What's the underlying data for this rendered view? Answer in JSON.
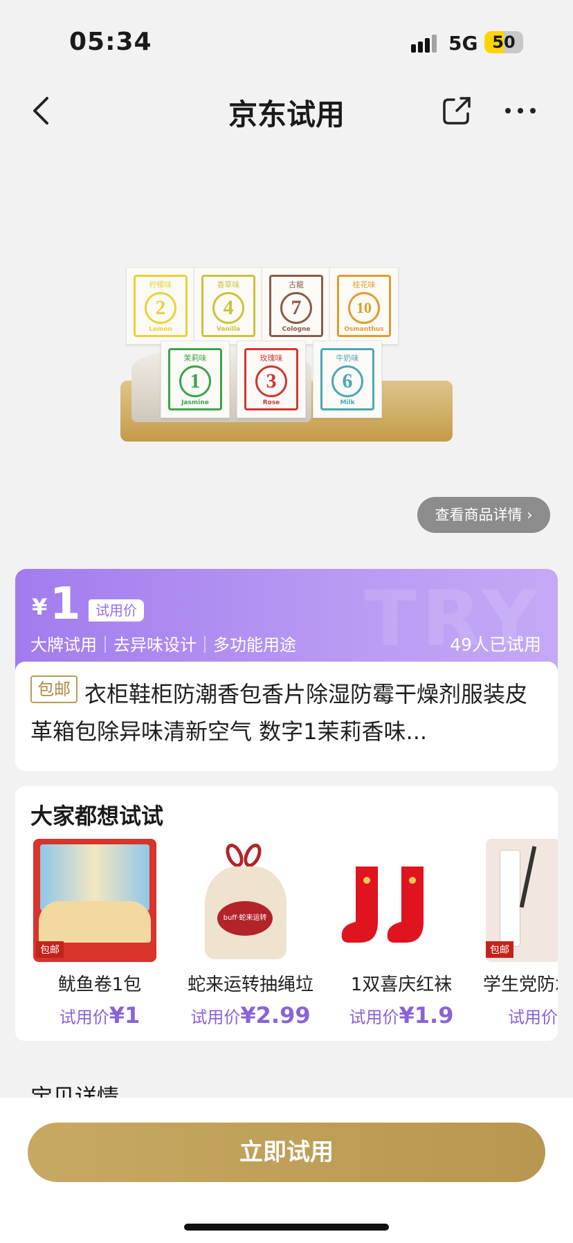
{
  "status_bar": {
    "time": "05:34",
    "network": "5G",
    "battery": "50",
    "battery_level": 0.5
  },
  "nav": {
    "title": "京东试用"
  },
  "hero": {
    "sachets": [
      {
        "number": "2",
        "flavor": "柠檬味",
        "english": "Lemon",
        "color": "#e7d43a"
      },
      {
        "number": "4",
        "flavor": "香草味",
        "english": "Vanilla",
        "color": "#c9c43b"
      },
      {
        "number": "7",
        "flavor": "古龍",
        "english": "Cologne",
        "color": "#8a5c4a"
      },
      {
        "number": "10",
        "flavor": "桂花味",
        "english": "Osmanthus",
        "color": "#e39b2b"
      },
      {
        "number": "1",
        "flavor": "茉莉味",
        "english": "Jasmine",
        "color": "#3ca34b"
      },
      {
        "number": "3",
        "flavor": "玫瑰味",
        "english": "Rose",
        "color": "#d2352f"
      },
      {
        "number": "6",
        "flavor": "牛奶味",
        "english": "Milk",
        "color": "#4aa7b3"
      }
    ],
    "detail_button": "查看商品详情 ›"
  },
  "price": {
    "currency": "¥",
    "value": "1",
    "tag": "试用价",
    "watermark": "TRY",
    "features": "大牌试用｜去异味设计｜多功能用途",
    "tried": "49人已试用"
  },
  "product": {
    "ship_badge": "包邮",
    "title": "衣柜鞋柜防潮香包香片除湿防霉干燥剂服装皮革箱包除异味清新空气 数字1茉莉香味..."
  },
  "recommend": {
    "title": "大家都想试试",
    "price_prefix": "试用价",
    "items": [
      {
        "name": "鱿鱼卷1包",
        "price": "¥1",
        "img_text": "包邮"
      },
      {
        "name": "蛇来运转抽绳垃",
        "price": "¥2.99",
        "img_text": "buff·蛇来运转"
      },
      {
        "name": "1双喜庆红袜",
        "price": "¥1.9",
        "img_text": ""
      },
      {
        "name": "学生党防水",
        "price": "",
        "img_text": "包邮"
      }
    ]
  },
  "section": {
    "title": "宝贝详情"
  },
  "bottom": {
    "button": "立即试用"
  },
  "colors": {
    "accent_purple": "#a27cee",
    "gold": "#c0a05a",
    "price_text": "#8a63d6"
  }
}
